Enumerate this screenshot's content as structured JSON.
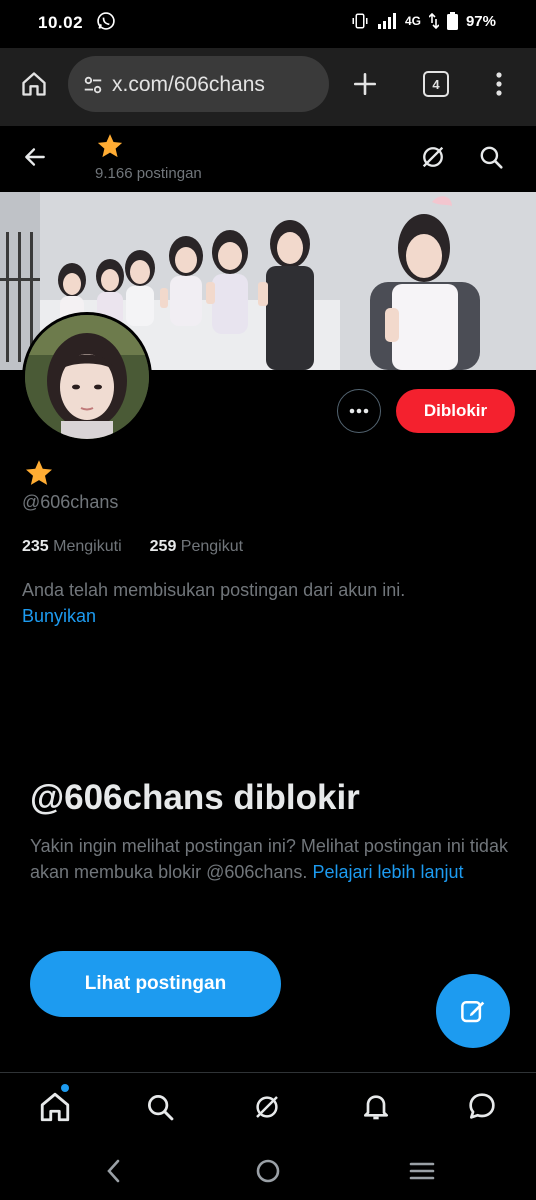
{
  "status_bar": {
    "time": "10.02",
    "network": "4G",
    "battery": "97%",
    "icons": [
      "whatsapp-icon",
      "vibrate-icon",
      "signal-icon",
      "data-arrows-icon",
      "battery-icon"
    ]
  },
  "browser": {
    "url": "x.com/606chans",
    "tab_count": "4",
    "icons": [
      "home-icon",
      "site-settings-icon",
      "new-tab-plus-icon",
      "tab-switcher-icon",
      "overflow-menu-icon"
    ]
  },
  "profile_header": {
    "post_count": "9.166 postingan",
    "display_name_icon": "star-emoji"
  },
  "profile": {
    "handle": "@606chans",
    "following_count": "235",
    "following_label": "Mengikuti",
    "followers_count": "259",
    "followers_label": "Pengikut",
    "blocked_button": "Diblokir"
  },
  "mute_notice": {
    "text": "Anda telah membisukan postingan dari akun ini.",
    "unmute_link": "Bunyikan"
  },
  "blocked_section": {
    "title": "@606chans diblokir",
    "description": "Yakin ingin melihat postingan ini? Melihat postingan ini tidak akan membuka blokir @606chans.",
    "learn_more": "Pelajari lebih lanjut",
    "view_button": "Lihat postingan"
  },
  "bottom_nav": {
    "items": [
      "home-icon",
      "search-icon",
      "grok-icon",
      "notifications-icon",
      "messages-icon"
    ]
  },
  "colors": {
    "background": "#000000",
    "accent": "#1d9bf0",
    "blocked_red": "#f4212e",
    "muted_text": "#71767b",
    "primary_text": "#e7e9ea"
  }
}
